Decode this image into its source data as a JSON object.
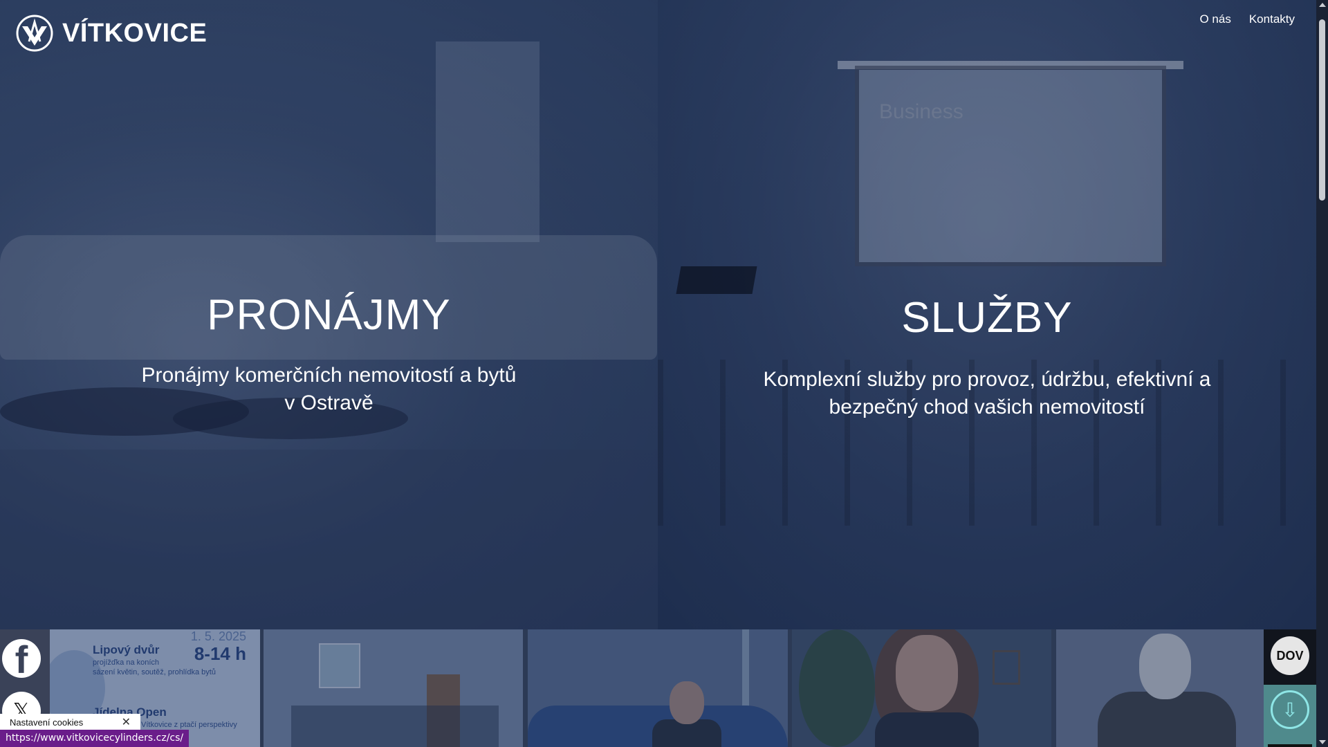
{
  "brand": {
    "name": "VÍTKOVICE"
  },
  "nav": {
    "about": "O nás",
    "contacts": "Kontakty"
  },
  "panels": [
    {
      "title": "PRONÁJMY",
      "desc_line1": "Pronájmy komerčních nemovitostí a bytů",
      "desc_line2": "v Ostravě"
    },
    {
      "title": "SLUŽBY",
      "desc_line1": "Komplexní služby pro provoz, údržbu, efektivní a",
      "desc_line2": "bezpečný chod vašich nemovitostí"
    }
  ],
  "scene": {
    "screen_text": "Business"
  },
  "tiles": {
    "tile1": {
      "date": "1. 5. 2025",
      "time": "8-14 h",
      "title": "Lipový dvůr",
      "line1": "projížďka na koních",
      "line2": "sázení květin, soutěž, prohlídka bytů",
      "line3": "",
      "title2": "Jídelna Open",
      "line4": "Vítkovice z ptačí perspektivy"
    }
  },
  "badges": {
    "dov": "DOV"
  },
  "social": {
    "facebook": "f",
    "x": "𝕏"
  },
  "cookie": {
    "label": "Nastavení cookies",
    "close": "✕"
  },
  "status": {
    "url": "https://www.vitkovicecylinders.cz/cs/"
  },
  "colors": {
    "accent": "#6a1d8a",
    "overlay": "#1b2a45"
  }
}
